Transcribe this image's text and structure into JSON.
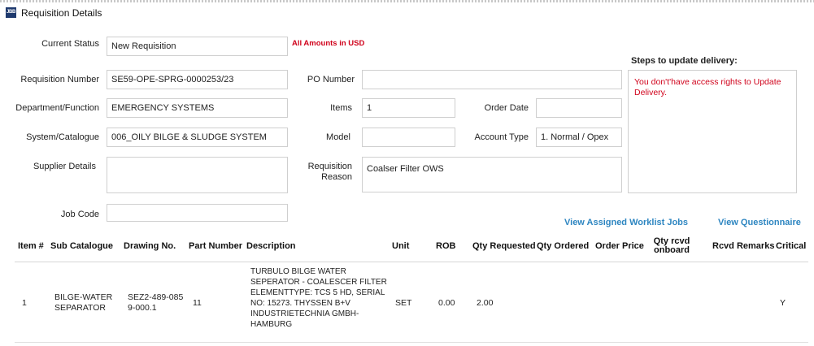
{
  "window": {
    "title": "Requisition Details",
    "icon_text": "JBB"
  },
  "form": {
    "current_status_label": "Current Status",
    "current_status": "New Requisition",
    "amounts_note": "All Amounts in USD",
    "requisition_number_label": "Requisition Number",
    "requisition_number": "SE59-OPE-SPRG-0000253/23",
    "department_label": "Department/Function",
    "department": "EMERGENCY SYSTEMS",
    "system_label": "System/Catalogue",
    "system": "006_OILY BILGE & SLUDGE SYSTEM",
    "supplier_label": "Supplier Details",
    "supplier": "",
    "job_code_label": "Job Code",
    "job_code": "",
    "po_number_label": "PO Number",
    "po_number": "",
    "items_label": "Items",
    "items": "1",
    "model_label": "Model",
    "model": "",
    "reason_label_line1": "Requisition",
    "reason_label_line2": "Reason",
    "reason": "Coalser Filter OWS",
    "order_date_label": "Order Date",
    "order_date": "",
    "account_type_label": "Account Type",
    "account_type": "1. Normal / Opex"
  },
  "steps": {
    "title": "Steps to update delivery:",
    "message": "You don't'have access rights to Update Delivery."
  },
  "links": {
    "worklist": "View Assigned Worklist Jobs",
    "questionnaire": "View Questionnaire"
  },
  "table": {
    "headers": {
      "item": "Item #",
      "sub_catalogue": "Sub Catalogue",
      "drawing": "Drawing No.",
      "part": "Part Number",
      "description": "Description",
      "unit": "Unit",
      "rob": "ROB",
      "qty_requested": "Qty Requested",
      "qty_ordered": "Qty Ordered",
      "order_price": "Order Price",
      "qty_rcvd_line1": "Qty rcvd",
      "qty_rcvd_line2": "onboard",
      "rcvd_remarks": "Rcvd Remarks",
      "critical": "Critical"
    },
    "rows": [
      {
        "item": "1",
        "sub_catalogue": "BILGE-WATER\nSEPARATOR",
        "drawing": "SEZ2-489-085\n9-000.1",
        "part": "11",
        "description": "TURBULO BILGE WATER\nSEPERATOR - COALESCER FILTER\nELEMENTTYPE: TCS 5 HD,  SERIAL\nNO: 15273. THYSSEN B+V\nINDUSTRIETECHNIA GMBH-\nHAMBURG",
        "unit": "SET",
        "rob": "0.00",
        "qty_requested": "2.00",
        "qty_ordered": "",
        "order_price": "",
        "qty_rcvd": "",
        "rcvd_remarks": "",
        "critical": "Y"
      }
    ]
  }
}
